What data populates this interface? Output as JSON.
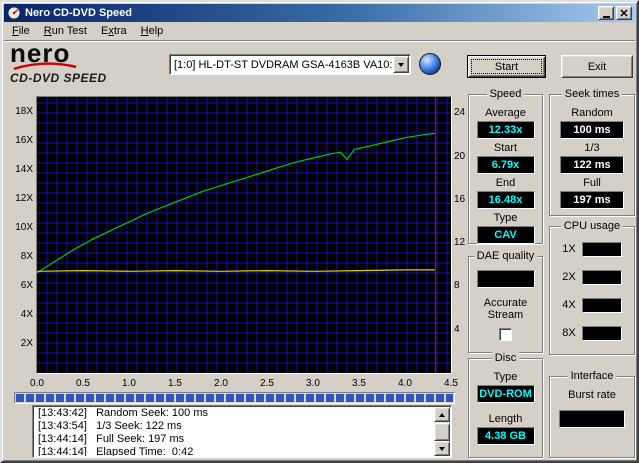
{
  "window": {
    "title": "Nero CD-DVD Speed"
  },
  "menu": [
    {
      "label": "File",
      "underline_index": 0
    },
    {
      "label": "Run Test",
      "underline_index": 0
    },
    {
      "label": "Extra",
      "underline_index": 1
    },
    {
      "label": "Help",
      "underline_index": 0
    }
  ],
  "logo": {
    "brand": "nero",
    "product": "CD-DVD SPEED"
  },
  "toolbar": {
    "drive_selector": {
      "value": "[1:0]  HL-DT-ST DVDRAM GSA-4163B VA10:"
    },
    "start_label": "Start",
    "exit_label": "Exit"
  },
  "chart_data": {
    "type": "line",
    "background": "#000000",
    "grid": {
      "color": "#1212b8",
      "spacing_px": 10
    },
    "x_axis": {
      "max": 4.5,
      "unit": "GB",
      "ticks": [
        {
          "v": 0.0,
          "label": "0.0"
        },
        {
          "v": 0.5,
          "label": "0.5"
        },
        {
          "v": 1.0,
          "label": "1.0"
        },
        {
          "v": 1.5,
          "label": "1.5"
        },
        {
          "v": 2.0,
          "label": "2.0"
        },
        {
          "v": 2.5,
          "label": "2.5"
        },
        {
          "v": 3.0,
          "label": "3.0"
        },
        {
          "v": 3.5,
          "label": "3.5"
        },
        {
          "v": 4.0,
          "label": "4.0"
        },
        {
          "v": 4.5,
          "label": "4.5"
        }
      ]
    },
    "y_axis_left": {
      "max": 19,
      "ticks": [
        {
          "v": 2,
          "label": "2X"
        },
        {
          "v": 4,
          "label": "4X"
        },
        {
          "v": 6,
          "label": "6X"
        },
        {
          "v": 8,
          "label": "8X"
        },
        {
          "v": 10,
          "label": "10X"
        },
        {
          "v": 12,
          "label": "12X"
        },
        {
          "v": 14,
          "label": "14X"
        },
        {
          "v": 16,
          "label": "16X"
        },
        {
          "v": 18,
          "label": "18X"
        }
      ]
    },
    "y_axis_right": {
      "max": 25.5,
      "ticks": [
        4,
        8,
        12,
        16,
        20,
        24
      ]
    },
    "series": [
      {
        "name": "read-speed",
        "color": "#00cc00",
        "points": [
          [
            0,
            6.9
          ],
          [
            0.2,
            7.7
          ],
          [
            0.4,
            8.5
          ],
          [
            0.6,
            9.2
          ],
          [
            0.8,
            9.8
          ],
          [
            1.0,
            10.4
          ],
          [
            1.2,
            11.0
          ],
          [
            1.4,
            11.5
          ],
          [
            1.6,
            12.0
          ],
          [
            1.8,
            12.5
          ],
          [
            2.0,
            12.9
          ],
          [
            2.2,
            13.3
          ],
          [
            2.4,
            13.7
          ],
          [
            2.6,
            14.1
          ],
          [
            2.8,
            14.5
          ],
          [
            3.0,
            14.8
          ],
          [
            3.2,
            15.1
          ],
          [
            3.3,
            15.2
          ],
          [
            3.37,
            14.7
          ],
          [
            3.45,
            15.4
          ],
          [
            3.6,
            15.6
          ],
          [
            3.8,
            15.9
          ],
          [
            4.0,
            16.2
          ],
          [
            4.2,
            16.4
          ],
          [
            4.33,
            16.5
          ]
        ]
      },
      {
        "name": "rotation-speed",
        "color": "#d6d600",
        "points": [
          [
            0,
            7.0
          ],
          [
            0.5,
            7.05
          ],
          [
            1.0,
            7.0
          ],
          [
            1.5,
            7.05
          ],
          [
            2.0,
            7.0
          ],
          [
            2.5,
            7.05
          ],
          [
            3.0,
            7.0
          ],
          [
            3.5,
            7.05
          ],
          [
            4.0,
            7.1
          ],
          [
            4.33,
            7.1
          ]
        ]
      }
    ],
    "end_marker_x": 4.33,
    "end_marker_color": "#cc0000"
  },
  "panels": {
    "speed": {
      "title": "Speed",
      "value_color": "#00ffff",
      "fields": [
        {
          "label": "Average",
          "value": "12.33x"
        },
        {
          "label": "Start",
          "value": "6.79x"
        },
        {
          "label": "End",
          "value": "16.48x"
        },
        {
          "label": "Type",
          "value": "CAV"
        }
      ]
    },
    "seek_times": {
      "title": "Seek times",
      "value_color": "#ffffff",
      "fields": [
        {
          "label": "Random",
          "value": "100 ms"
        },
        {
          "label": "1/3",
          "value": "122 ms"
        },
        {
          "label": "Full",
          "value": "197 ms"
        }
      ]
    },
    "cpu_usage": {
      "title": "CPU usage",
      "fields": [
        {
          "label": "1X",
          "value": ""
        },
        {
          "label": "2X",
          "value": ""
        },
        {
          "label": "4X",
          "value": ""
        },
        {
          "label": "8X",
          "value": ""
        }
      ]
    },
    "dae_quality": {
      "title": "DAE quality",
      "value": "",
      "checkbox_label": "Accurate Stream",
      "checked": false
    },
    "disc": {
      "title": "Disc",
      "value_color": "#00ffff",
      "fields": [
        {
          "label": "Type",
          "value": "DVD-ROM"
        },
        {
          "label": "Length",
          "value": "4.38 GB"
        }
      ]
    },
    "interface": {
      "title": "Interface",
      "fields": [
        {
          "label": "Burst rate",
          "value": ""
        }
      ]
    }
  },
  "progress": {
    "percent": 100
  },
  "log": {
    "lines": [
      "[13:43:42]   Random Seek: 100 ms",
      "[13:43:54]   1/3 Seek: 122 ms",
      "[13:44:14]   Full Seek: 197 ms",
      "[13:44:14]   Elapsed Time:  0:42"
    ]
  }
}
